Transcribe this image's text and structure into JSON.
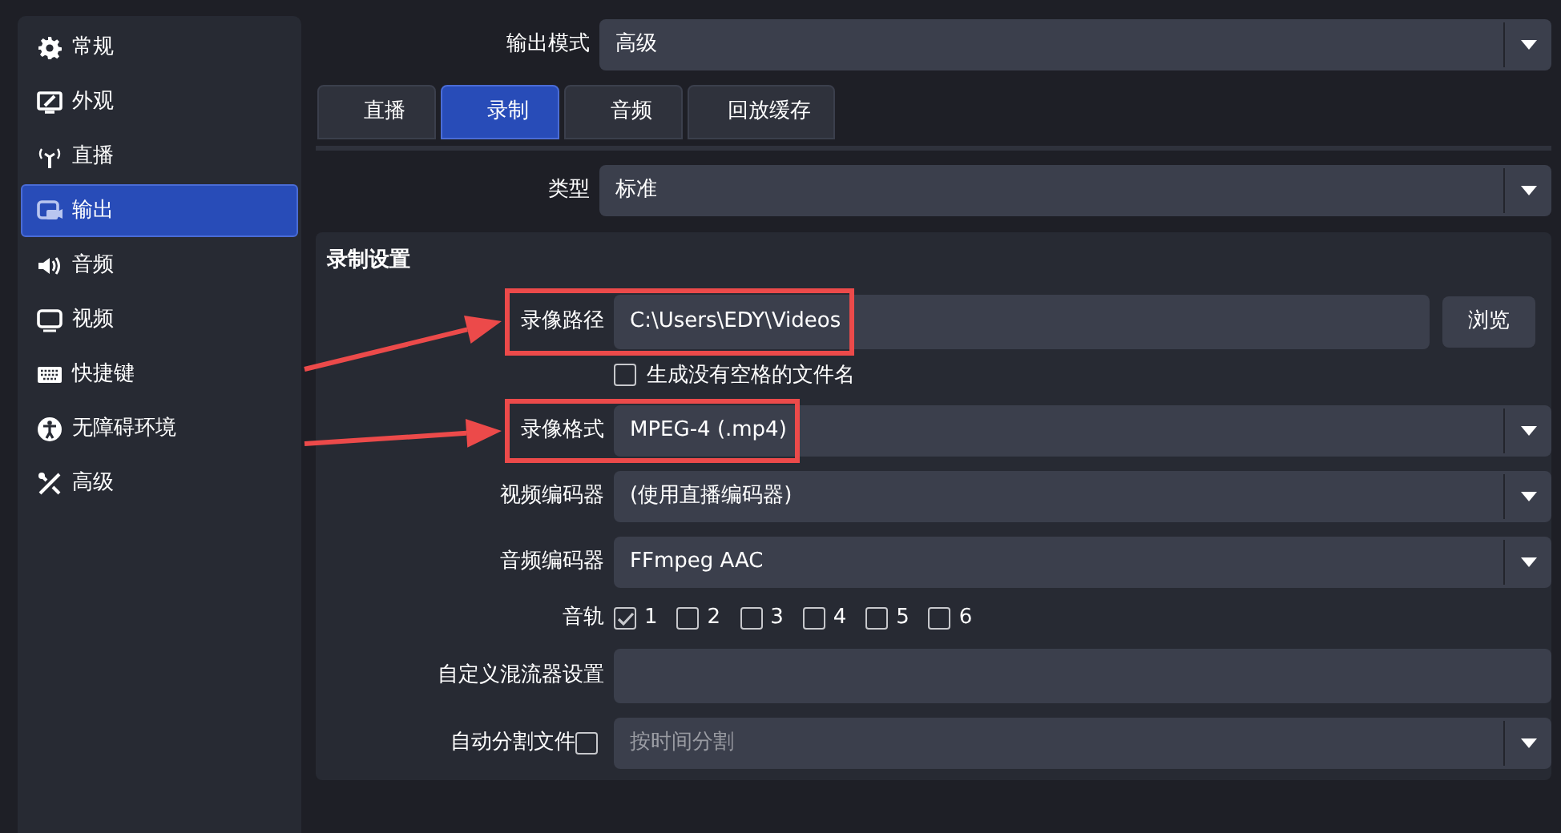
{
  "sidebar": {
    "items": [
      {
        "label": "常规",
        "selected": false
      },
      {
        "label": "外观",
        "selected": false
      },
      {
        "label": "直播",
        "selected": false
      },
      {
        "label": "输出",
        "selected": true
      },
      {
        "label": "音频",
        "selected": false
      },
      {
        "label": "视频",
        "selected": false
      },
      {
        "label": "快捷键",
        "selected": false
      },
      {
        "label": "无障碍环境",
        "selected": false
      },
      {
        "label": "高级",
        "selected": false
      }
    ]
  },
  "output_mode": {
    "label": "输出模式",
    "value": "高级"
  },
  "tabs": [
    {
      "label": "直播",
      "selected": false
    },
    {
      "label": "录制",
      "selected": true
    },
    {
      "label": "音频",
      "selected": false
    },
    {
      "label": "回放缓存",
      "selected": false
    }
  ],
  "type_field": {
    "label": "类型",
    "value": "标准"
  },
  "group": {
    "title": "录制设置",
    "rows": [
      {
        "kind": "path",
        "label": "录像路径",
        "value": "C:\\Users\\EDY\\Videos",
        "button": "浏览",
        "highlighted": true
      },
      {
        "kind": "checkbox",
        "label": "生成没有空格的文件名",
        "checked": false
      },
      {
        "kind": "select",
        "label": "录像格式",
        "value": "MPEG-4 (.mp4)",
        "highlighted": true
      },
      {
        "kind": "select",
        "label": "视频编码器",
        "value": "(使用直播编码器)",
        "highlighted": false
      },
      {
        "kind": "select",
        "label": "音频编码器",
        "value": "FFmpeg AAC",
        "highlighted": false
      },
      {
        "kind": "tracks",
        "label": "音轨",
        "tracks": [
          {
            "label": "1",
            "checked": true
          },
          {
            "label": "2",
            "checked": false
          },
          {
            "label": "3",
            "checked": false
          },
          {
            "label": "4",
            "checked": false
          },
          {
            "label": "5",
            "checked": false
          },
          {
            "label": "6",
            "checked": false
          }
        ]
      },
      {
        "kind": "input",
        "label": "自定义混流器设置"
      },
      {
        "kind": "split",
        "label": "自动分割文件",
        "checked": false,
        "value": "按时间分割",
        "disabled": true
      }
    ]
  }
}
